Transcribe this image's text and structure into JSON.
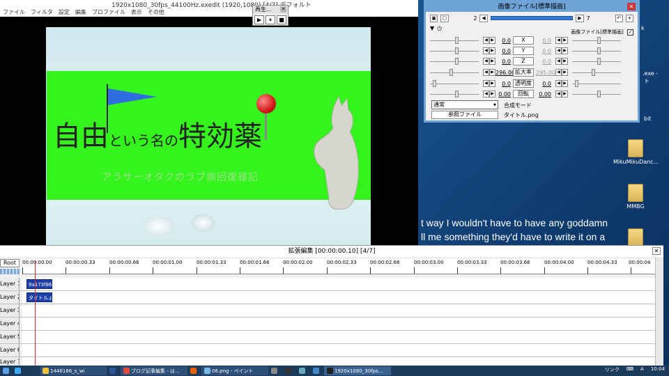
{
  "main_window": {
    "title": "1920x1080_30fps_44100Hz.exedit (1920,1080)  [4/7]  デフォルト",
    "menu": [
      "ファイル",
      "フィルタ",
      "設定",
      "編集",
      "プロファイル",
      "表示",
      "その他"
    ]
  },
  "preview": {
    "title_big": "自由",
    "title_small": "という名の",
    "title_big2": "特効薬",
    "subtitle": "アラサーオタクのラブ病回復雑記"
  },
  "play_window": {
    "title": "再生...",
    "buttons": [
      "▶",
      "⏸",
      "■"
    ]
  },
  "property_window": {
    "title": "画像ファイル[標準描画]",
    "frame_start": "2",
    "frame_end": "7",
    "checkbox_label": "画像ファイル[標準描画]",
    "params": [
      {
        "left": "0.0",
        "label": "X",
        "right": "0.0",
        "right_grey": true
      },
      {
        "left": "0.0",
        "label": "Y",
        "right": "0.0",
        "right_grey": true
      },
      {
        "left": "0.0",
        "label": "Z",
        "right": "0.0",
        "right_grey": true
      },
      {
        "left": "296.00",
        "label": "拡大率",
        "right": "295.00",
        "right_grey": true
      },
      {
        "left": "0.0",
        "label": "透明度",
        "right": "0.0",
        "right_grey": false
      },
      {
        "left": "0.00",
        "label": "回転",
        "right": "0.00",
        "right_grey": false
      }
    ],
    "blend_mode": "通常",
    "blend_label": "合成モード",
    "ref_button": "参照ファイル",
    "ref_file": "タイトル.png"
  },
  "desktop": {
    "subtitle_line1": "t way I wouldn't have to have any goddamn",
    "subtitle_line2": "ll me something they'd have to write it on a",
    "icons": [
      {
        "label": "MikuMikuDanc..."
      },
      {
        "label": "MMBG"
      }
    ],
    "fragments": [
      "k",
      ".exe -",
      "ト",
      "bit"
    ]
  },
  "timeline": {
    "title": "拡張編集 [00:00:00.10] [4/7]",
    "root_label": "Root",
    "ticks": [
      "00:00:00.00",
      "00:00:00.33",
      "00:00:00.66",
      "00:00:01.00",
      "00:00:01.33",
      "00:00:01.66",
      "00:00:02.00",
      "00:00:02.33",
      "00:00:02.66",
      "00:00:03.00",
      "00:00:03.33",
      "00:00:03.66",
      "00:00:04.00",
      "00:00:04.33",
      "00:00:04"
    ],
    "layers": [
      "Layer 1",
      "Layer 2",
      "Layer 3",
      "Layer 4",
      "Layer 5",
      "Layer 6",
      "Layer 7"
    ],
    "clips": [
      {
        "layer": 0,
        "label": "9a173f86"
      },
      {
        "layer": 1,
        "label": "タイトル.png"
      }
    ]
  },
  "taskbar": {
    "items": [
      "1446186_s_wi",
      "ブログ記事編集 - は...",
      "06.png - ペイント",
      "1920x1080_30fps..."
    ],
    "link_label": "リンク",
    "clock": "10:04"
  }
}
